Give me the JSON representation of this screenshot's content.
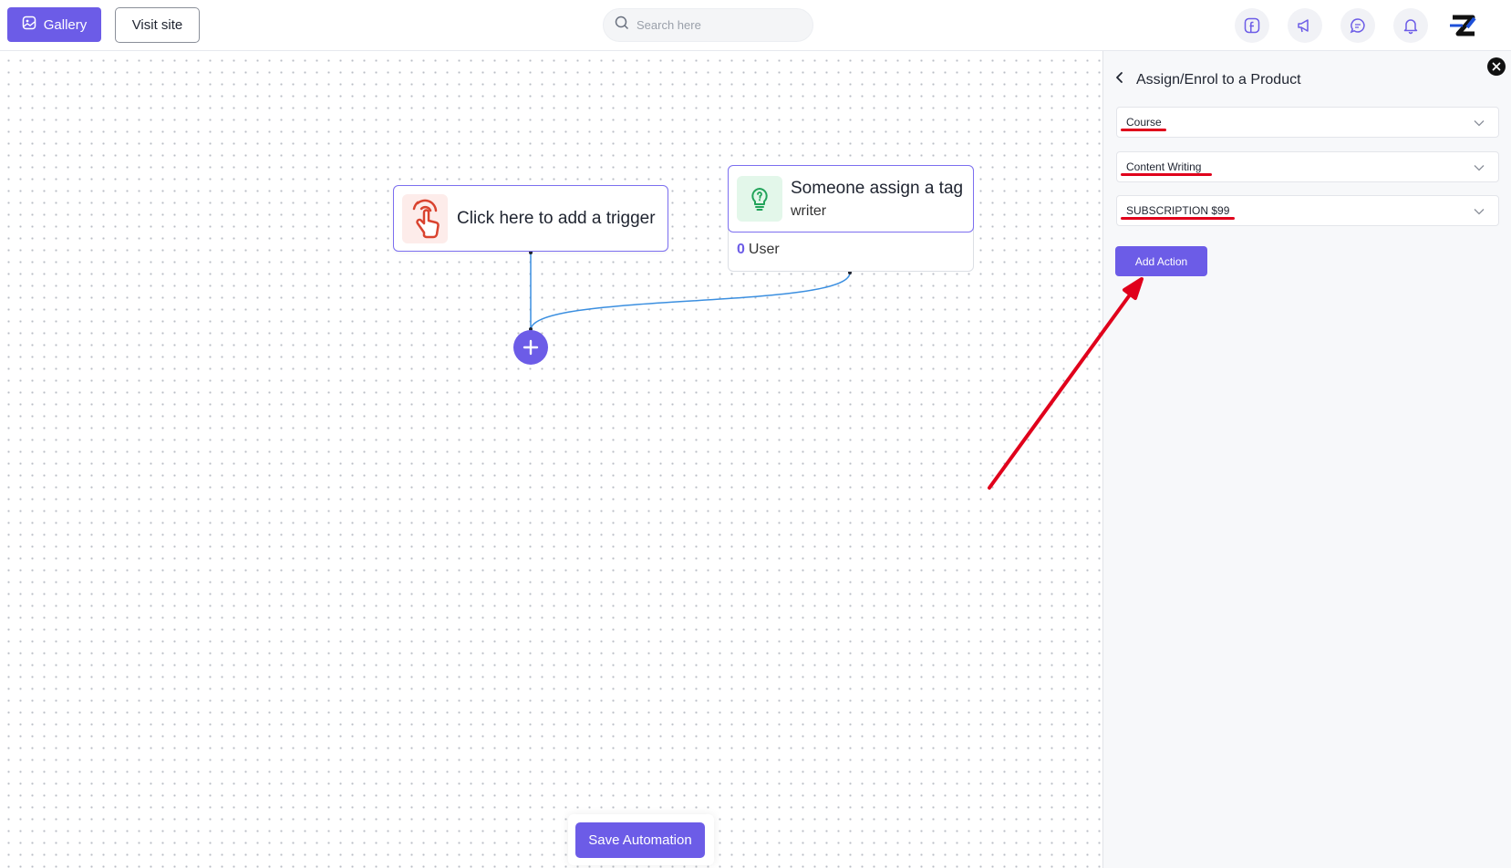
{
  "header": {
    "gallery_label": "Gallery",
    "visit_label": "Visit site",
    "search_placeholder": "Search here",
    "icons": [
      "facebook-icon",
      "megaphone-icon",
      "chat-icon",
      "bell-icon"
    ]
  },
  "canvas": {
    "trigger_node": {
      "label": "Click here to add a trigger"
    },
    "tag_node": {
      "title": "Someone assign a tag",
      "subtitle": "writer",
      "user_count": "0",
      "user_label": "User"
    },
    "save_label": "Save Automation"
  },
  "panel": {
    "title": "Assign/Enrol to a Product",
    "fields": [
      {
        "value": "Course"
      },
      {
        "value": "Content Writing"
      },
      {
        "value": "SUBSCRIPTION $99"
      }
    ],
    "add_action_label": "Add Action"
  },
  "colors": {
    "accent": "#6c5ce7",
    "annotation": "#e0001b",
    "connector": "#3b8fe0"
  }
}
